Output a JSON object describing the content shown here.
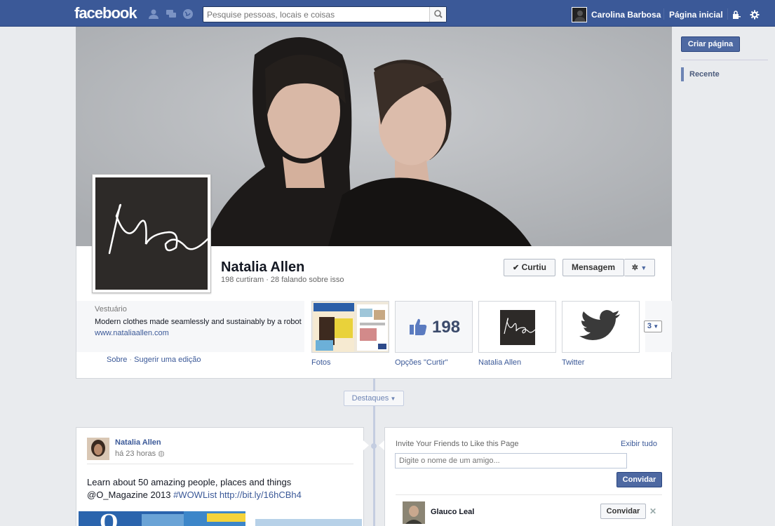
{
  "topbar": {
    "logo": "facebook",
    "search_placeholder": "Pesquise pessoas, locais e coisas",
    "user_name": "Carolina Barbosa",
    "home_label": "Página inicial",
    "brand_color": "#3b5998"
  },
  "rail": {
    "create_page": "Criar página",
    "recent": "Recente"
  },
  "page": {
    "name": "Natalia Allen",
    "stats": "198 curtiram · 28 falando sobre isso",
    "liked_label": "Curtiu",
    "message_label": "Mensagem",
    "category": "Vestuário",
    "about_text": "Modern clothes made seamlessly and sustainably by a robot ",
    "about_link": "www.nataliaallen.com",
    "about_link_label": "Sobre",
    "suggest_label": "Sugerir uma edição"
  },
  "apps": {
    "items": [
      {
        "label": "Fotos"
      },
      {
        "label": "Opções \"Curtir\"",
        "count": "198"
      },
      {
        "label": "Natalia Allen"
      },
      {
        "label": "Twitter"
      }
    ],
    "more": "3"
  },
  "timeline": {
    "destaques": "Destaques"
  },
  "post": {
    "author": "Natalia Allen",
    "time": "há 23 horas",
    "text_plain": "Learn about 50 amazing people, places and things @O_Magazine 2013 ",
    "hashtag": "#WOWList",
    "link": "http://bit.ly/16hCBh4"
  },
  "invite": {
    "title": "Invite Your Friends to Like this Page",
    "show_all": "Exibir tudo",
    "input_placeholder": "Digite o nome de um amigo...",
    "button": "Convidar",
    "friend": {
      "name": "Glauco Leal",
      "button": "Convidar"
    }
  }
}
